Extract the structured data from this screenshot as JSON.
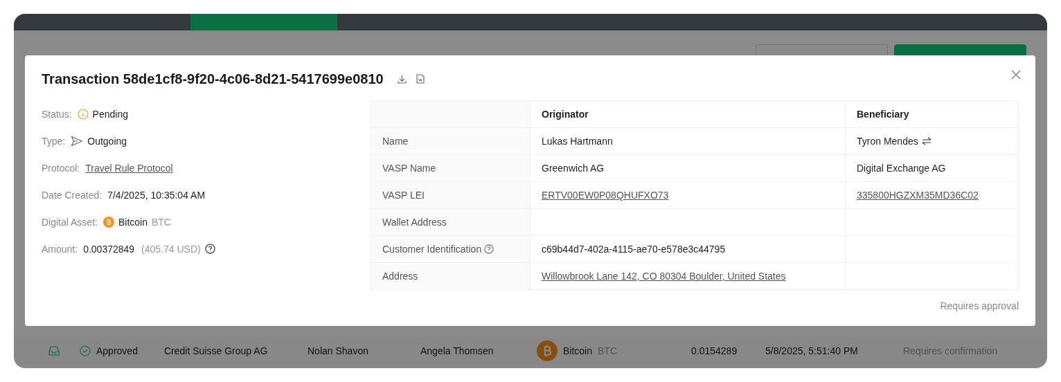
{
  "app": {
    "buttons": [
      {
        "kind": "secondary"
      },
      {
        "kind": "primary"
      }
    ],
    "row": {
      "cells": [
        {
          "kind": "status",
          "text": "Approved"
        },
        {
          "kind": "text",
          "text": "Credit Suisse Group AG"
        },
        {
          "kind": "text",
          "text": "Nolan Shavon"
        },
        {
          "kind": "text",
          "text": "Angela Thomsen"
        },
        {
          "kind": "asset",
          "text": "Bitcoin",
          "unit": "BTC"
        },
        {
          "kind": "text",
          "text": "0.0154289"
        },
        {
          "kind": "text",
          "text": "5/8/2025, 5:51:40 PM"
        },
        {
          "kind": "muted",
          "text": "Requires confirmation"
        }
      ]
    }
  },
  "modal": {
    "title": "Transaction 58de1cf8-9f20-4c06-8d21-5417699e0810",
    "details": [
      {
        "label": "Status",
        "kind": "status",
        "value": "Pending"
      },
      {
        "label": "Type",
        "kind": "type",
        "value": "Outgoing"
      },
      {
        "label": "Protocol",
        "kind": "link",
        "value": "Travel Rule Protocol"
      },
      {
        "label": "Date Created",
        "kind": "text",
        "value": "7/4/2025, 10:35:04 AM"
      },
      {
        "label": "Digital Asset",
        "kind": "asset",
        "value": "Bitcoin",
        "unit": "BTC"
      },
      {
        "label": "Amount",
        "kind": "amount",
        "value": "0.00372849",
        "note": "(405.74 USD)"
      }
    ],
    "colon": ":",
    "table": {
      "columns": [
        "Originator",
        "Beneficiary"
      ],
      "rows": [
        {
          "label": "Name",
          "help": false,
          "cells": [
            {
              "kind": "text",
              "text": "Lukas Hartmann",
              "swap": false
            },
            {
              "kind": "text",
              "text": "Tyron Mendes",
              "swap": true
            }
          ]
        },
        {
          "label": "VASP Name",
          "help": false,
          "cells": [
            {
              "kind": "text",
              "text": "Greenwich AG",
              "swap": false
            },
            {
              "kind": "text",
              "text": "Digital Exchange AG",
              "swap": false
            }
          ]
        },
        {
          "label": "VASP LEI",
          "help": false,
          "cells": [
            {
              "kind": "link",
              "text": "ERTV00EW0P08QHUFXO73",
              "swap": false
            },
            {
              "kind": "link",
              "text": "335800HGZXM35MD36C02",
              "swap": false
            }
          ]
        },
        {
          "label": "Wallet Address",
          "help": false,
          "cells": [
            {
              "kind": "empty"
            },
            {
              "kind": "empty"
            }
          ]
        },
        {
          "label": "Customer Identification",
          "help": true,
          "cells": [
            {
              "kind": "text",
              "text": "c69b44d7-402a-4115-ae70-e578e3c44795",
              "swap": false
            },
            {
              "kind": "empty"
            }
          ]
        },
        {
          "label": "Address",
          "help": false,
          "cells": [
            {
              "kind": "link",
              "text": "Willowbrook Lane 142, CO 80304 Boulder, United States",
              "swap": false
            },
            {
              "kind": "empty"
            }
          ]
        }
      ]
    },
    "footer": "Requires approval"
  }
}
